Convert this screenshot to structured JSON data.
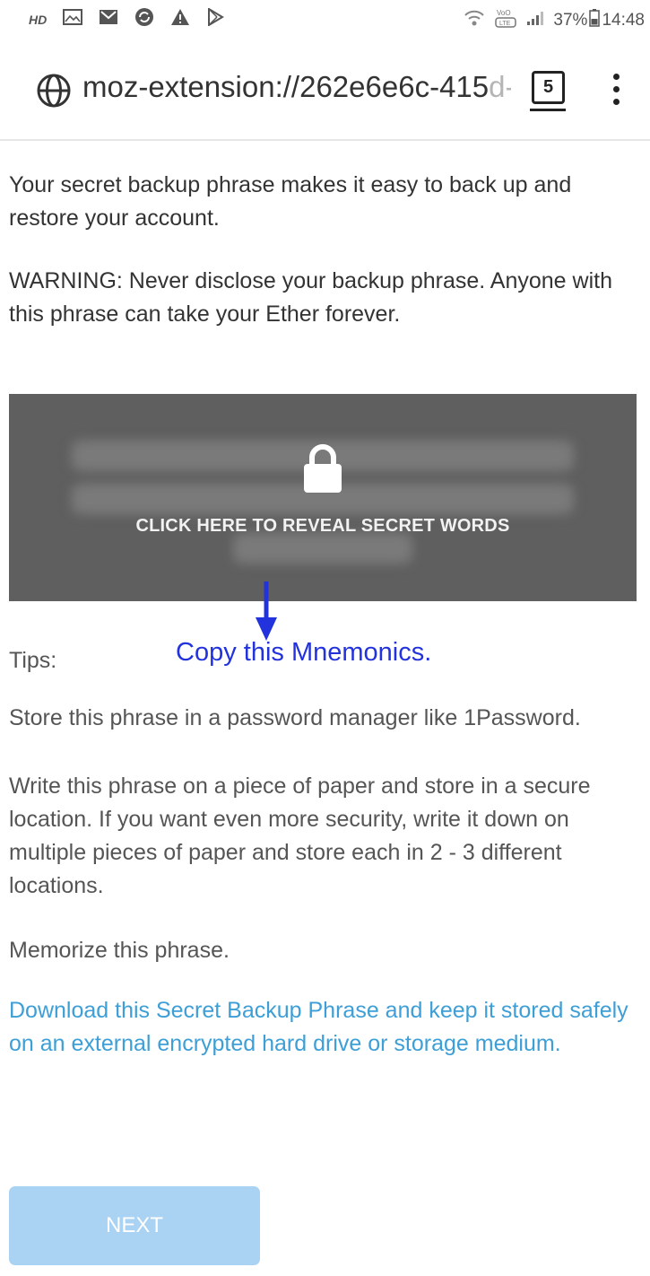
{
  "status_bar": {
    "hd_label": "HD",
    "left_icons": [
      "gallery-icon",
      "gmail-icon",
      "sync-icon",
      "warning-icon",
      "play-store-icon"
    ],
    "battery_percent": "37%",
    "time": "14:48"
  },
  "url_bar": {
    "url_main": "moz-extension://262e6e6c-415",
    "url_faded": "d-",
    "tab_count": "5"
  },
  "content": {
    "intro": "Your secret backup phrase makes it easy to back up and restore your account.",
    "warning": "WARNING: Never disclose your backup phrase. Anyone with this phrase can take your Ether forever.",
    "reveal_label": "CLICK HERE TO REVEAL SECRET WORDS",
    "annotation": "Copy this Mnemonics.",
    "tips_heading": "Tips:",
    "tip1": "Store this phrase in a password manager like 1Password.",
    "tip2": "Write this phrase on a piece of paper and store in a secure location. If you want even more security, write it down on multiple pieces of paper and store each in 2 - 3 different locations.",
    "tip3": "Memorize this phrase.",
    "download_link": "Download this Secret Backup Phrase and keep it stored safely on an external encrypted hard drive or storage medium.",
    "next_button": "NEXT"
  },
  "colors": {
    "link": "#3d9fd6",
    "reveal_box": "#5f5f5f",
    "annotation": "#2233dd",
    "next_button": "#a9d2f3"
  }
}
